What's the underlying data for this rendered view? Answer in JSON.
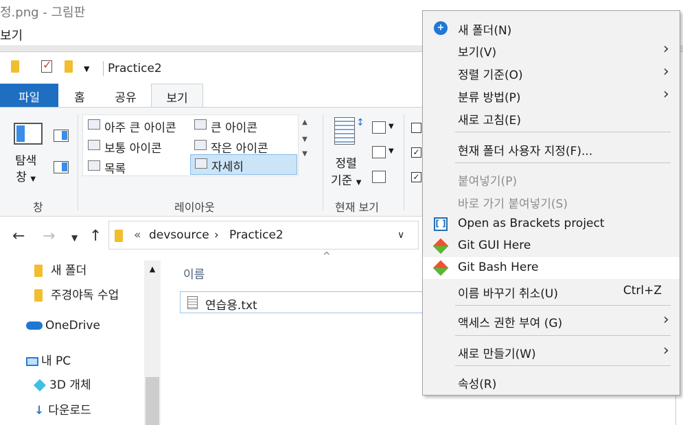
{
  "paint": {
    "title": "정.png - 그림판",
    "menu": "보기"
  },
  "qat": {
    "title": "Practice2"
  },
  "tabs": {
    "file": "파일",
    "home": "홈",
    "share": "공유",
    "view": "보기"
  },
  "ribbon": {
    "nav_pane": "탐색",
    "nav_pane2": "창",
    "nav_group": "창",
    "layout_items": [
      "아주 큰 아이콘",
      "큰 아이콘",
      "보통 아이콘",
      "작은 아이콘",
      "목록",
      "자세히"
    ],
    "layout_group": "레이아웃",
    "sort_label1": "정렬",
    "sort_label2": "기준",
    "current_view_group": "현재 보기"
  },
  "address": {
    "prefix": "«",
    "crumb1": "devsource",
    "crumb2": "Practice2"
  },
  "tree": {
    "items": [
      "새 폴더",
      "주경야독 수업",
      "OneDrive",
      "내 PC",
      "3D 개체",
      "다운로드"
    ]
  },
  "content": {
    "column_name": "이름",
    "file": "연습용.txt"
  },
  "context_menu": {
    "new_folder": "새 폴더(N)",
    "view": "보기(V)",
    "sort_by": "정렬 기준(O)",
    "group_by": "분류 방법(P)",
    "refresh": "새로 고침(E)",
    "customize": "현재 폴더 사용자 지정(F)...",
    "paste": "붙여넣기(P)",
    "paste_shortcut": "바로 가기 붙여넣기(S)",
    "brackets": "Open as Brackets project",
    "git_gui": "Git GUI Here",
    "git_bash": "Git Bash Here",
    "undo_rename": "이름 바꾸기 취소(U)",
    "undo_shortcut": "Ctrl+Z",
    "give_access": "액세스 권한 부여 (G)",
    "new": "새로 만들기(W)",
    "properties": "속성(R)"
  }
}
